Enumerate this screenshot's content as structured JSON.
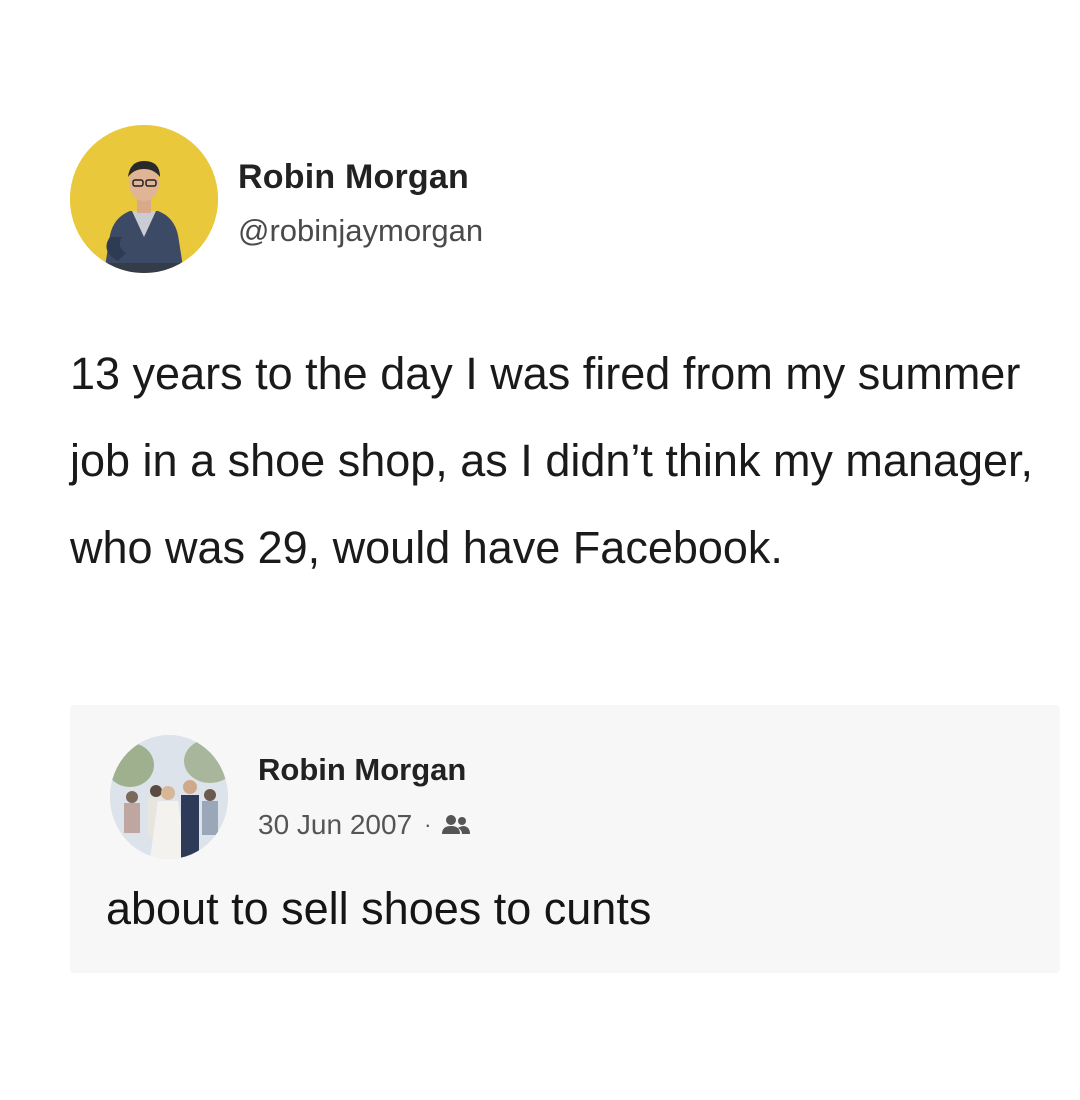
{
  "tweet": {
    "author_name": "Robin Morgan",
    "author_handle": "@robinjaymorgan",
    "avatar_icon": "profile-photo-icon",
    "avatar_background": "#e9c83c",
    "text": "13 years to the day I was fired from my summer job in a shoe shop, as I didn’t think my manager, who was 29, would have Facebook."
  },
  "facebook_post": {
    "author_name": "Robin Morgan",
    "date": "30 Jun 2007",
    "separator": "·",
    "audience_icon": "friends-icon",
    "avatar_icon": "profile-photo-icon",
    "text": "about to sell shoes to cunts"
  }
}
